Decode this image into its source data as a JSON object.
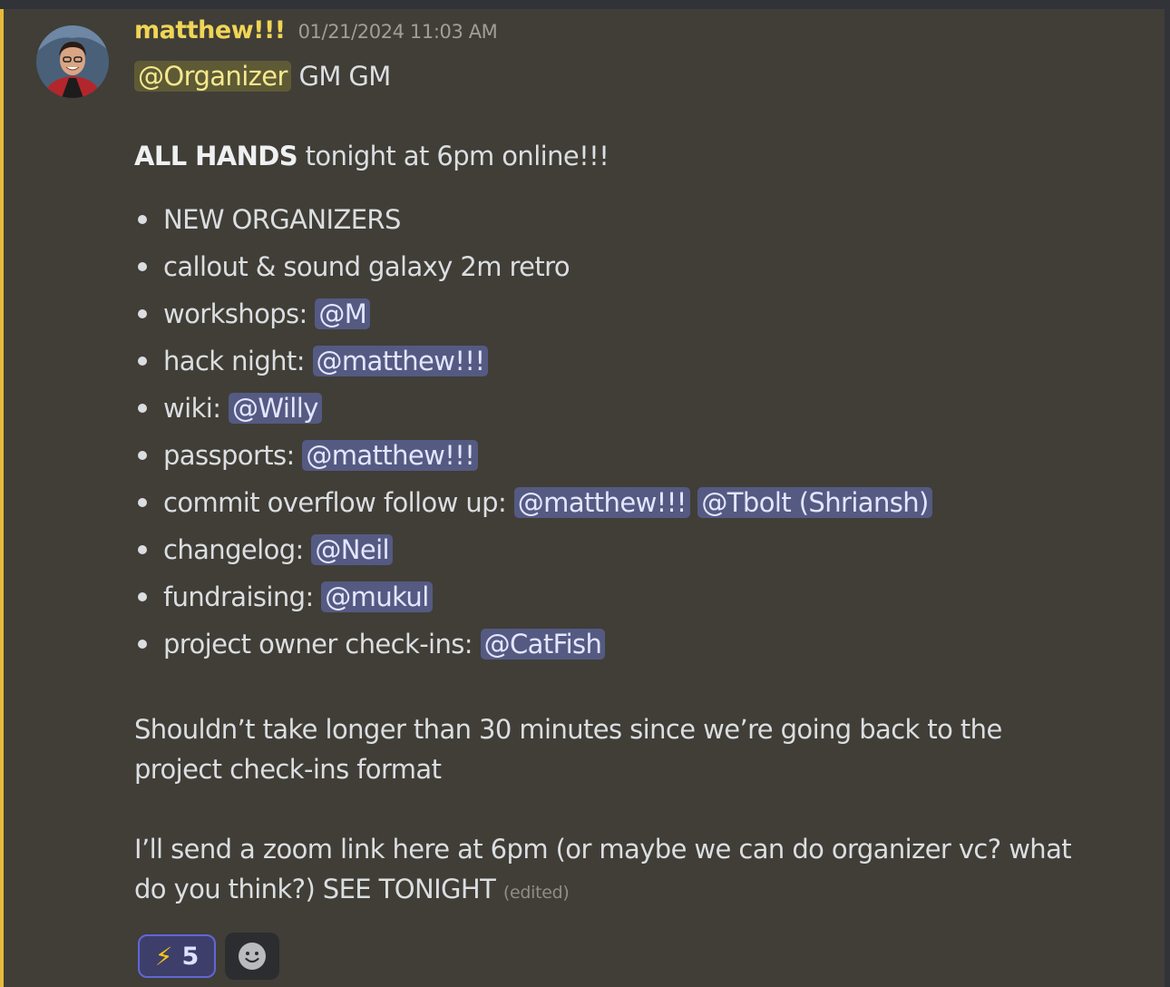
{
  "message": {
    "username": "matthew!!!",
    "timestamp": "01/21/2024 11:03 AM",
    "line1": {
      "role_mention": "@Organizer",
      "text": " GM GM"
    },
    "line2": {
      "bold": "ALL HANDS",
      "text": " tonight at 6pm online!!!"
    },
    "items": [
      {
        "text": "NEW ORGANIZERS",
        "mentions": []
      },
      {
        "text": "callout & sound galaxy 2m retro",
        "mentions": []
      },
      {
        "text": "workshops: ",
        "mentions": [
          "@M"
        ]
      },
      {
        "text": "hack night: ",
        "mentions": [
          "@matthew!!!"
        ]
      },
      {
        "text": "wiki: ",
        "mentions": [
          "@Willy"
        ]
      },
      {
        "text": "passports: ",
        "mentions": [
          "@matthew!!!"
        ]
      },
      {
        "text": "commit overflow follow up: ",
        "mentions": [
          "@matthew!!!",
          "@Tbolt (Shriansh)"
        ]
      },
      {
        "text": "changelog: ",
        "mentions": [
          "@Neil"
        ]
      },
      {
        "text": "fundraising: ",
        "mentions": [
          "@mukul"
        ]
      },
      {
        "text": "project owner check-ins: ",
        "mentions": [
          "@CatFish"
        ]
      }
    ],
    "para1": "Shouldn’t take longer than 30 minutes since we’re going back to the project check-ins format",
    "para2": "I’ll send a zoom link here at 6pm (or maybe we can do organizer vc? what do you think?) SEE TONIGHT",
    "edited_label": "(edited)"
  },
  "reactions": [
    {
      "emoji": "⚡",
      "count": "5"
    }
  ],
  "icons": {
    "reaction_emoji": "lightning-icon",
    "add_reaction": "smiley-face-icon"
  },
  "colors": {
    "highlight_background": "#403e37",
    "highlight_bar": "#e8b93a",
    "username": "#f0d556",
    "mention_bg": "#555a82",
    "role_mention_bg": "#5e5a35"
  }
}
